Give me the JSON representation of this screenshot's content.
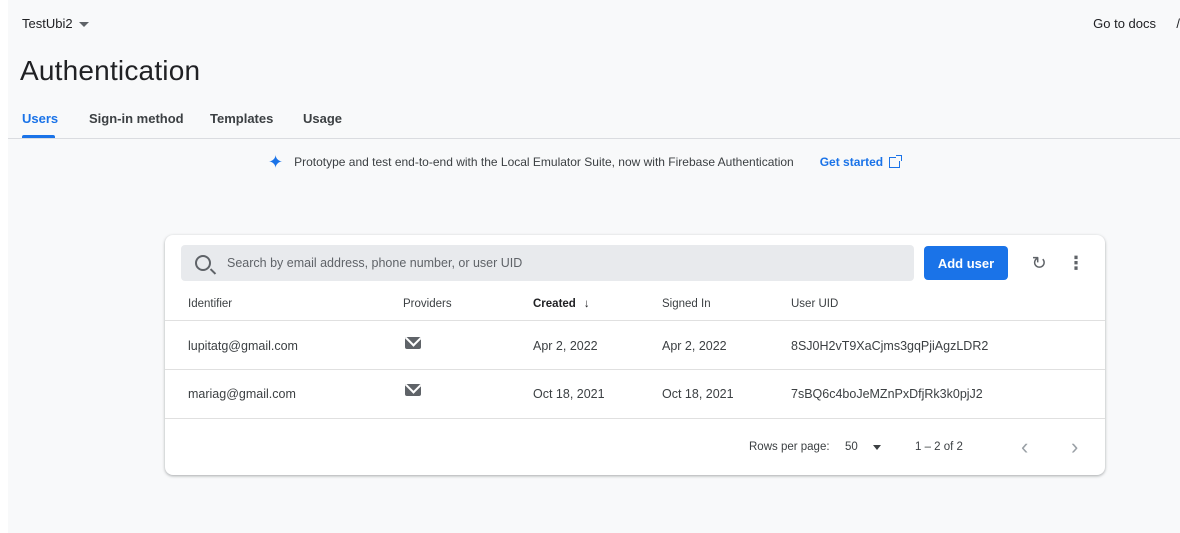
{
  "header": {
    "project": "TestUbi2",
    "docs_link": "Go to docs",
    "edge_char": "/"
  },
  "page": {
    "title": "Authentication"
  },
  "tabs": [
    {
      "label": "Users",
      "active": true
    },
    {
      "label": "Sign-in method",
      "active": false
    },
    {
      "label": "Templates",
      "active": false
    },
    {
      "label": "Usage",
      "active": false
    }
  ],
  "banner": {
    "text": "Prototype and test end-to-end with the Local Emulator Suite, now with Firebase Authentication",
    "link": "Get started"
  },
  "users": {
    "search_placeholder": "Search by email address, phone number, or user UID",
    "add_label": "Add user",
    "columns": [
      "Identifier",
      "Providers",
      "Created",
      "Signed In",
      "User UID"
    ],
    "sort_column": "Created",
    "rows": [
      {
        "identifier": "lupitatg@gmail.com",
        "provider": "email-icon",
        "created": "Apr 2, 2022",
        "signed_in": "Apr 2, 2022",
        "uid": "8SJ0H2vT9XaCjms3gqPjiAgzLDR2"
      },
      {
        "identifier": "mariag@gmail.com",
        "provider": "email-icon",
        "created": "Oct 18, 2021",
        "signed_in": "Oct 18, 2021",
        "uid": "7sBQ6c4boJeMZnPxDfjRk3k0pjJ2"
      }
    ],
    "pagination": {
      "rows_per_page_label": "Rows per page:",
      "rows_per_page": "50",
      "range": "1 – 2 of 2"
    }
  },
  "colors": {
    "accent": "#1a73e8",
    "background": "#f8f9fa"
  }
}
